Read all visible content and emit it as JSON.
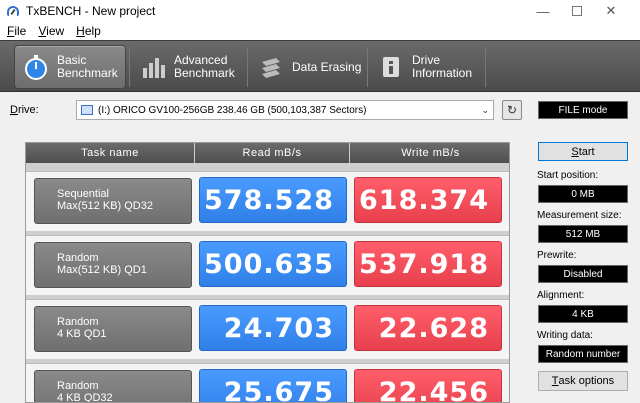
{
  "window": {
    "title": "TxBENCH - New project"
  },
  "menu": [
    {
      "key": "F",
      "rest": "ile"
    },
    {
      "key": "V",
      "rest": "iew"
    },
    {
      "key": "H",
      "rest": "elp"
    }
  ],
  "toolbar": {
    "basic": [
      "Basic",
      "Benchmark"
    ],
    "advanced": [
      "Advanced",
      "Benchmark"
    ],
    "erasing": "Data Erasing",
    "info": [
      "Drive",
      "Information"
    ]
  },
  "drive": {
    "label_key": "D",
    "label_rest": "rive:",
    "value": "(I:) ORICO GV100-256GB  238.46 GB (500,103,387 Sectors)",
    "mode": "FILE mode"
  },
  "table": {
    "headers": [
      "Task name",
      "Read mB/s",
      "Write mB/s"
    ],
    "rows": [
      {
        "task": [
          "Sequential",
          "Max(512 KB) QD32"
        ],
        "read": "578.528",
        "write": "618.374"
      },
      {
        "task": [
          "Random",
          "Max(512 KB) QD1"
        ],
        "read": "500.635",
        "write": "537.918"
      },
      {
        "task": [
          "Random",
          "4 KB QD1"
        ],
        "read": "24.703",
        "write": "22.628"
      },
      {
        "task": [
          "Random",
          "4 KB QD32"
        ],
        "read": "25.675",
        "write": "22.456"
      }
    ]
  },
  "settings": {
    "start": {
      "key": "S",
      "rest": "tart"
    },
    "start_position_label": "Start position:",
    "start_position": "0 MB",
    "measurement_size_label": "Measurement size:",
    "measurement_size": "512 MB",
    "prewrite_label": "Prewrite:",
    "prewrite": "Disabled",
    "alignment_label": "Alignment:",
    "alignment": "4 KB",
    "writing_data_label": "Writing data:",
    "writing_data": "Random number",
    "task_options": {
      "key": "T",
      "rest": "ask options"
    }
  }
}
